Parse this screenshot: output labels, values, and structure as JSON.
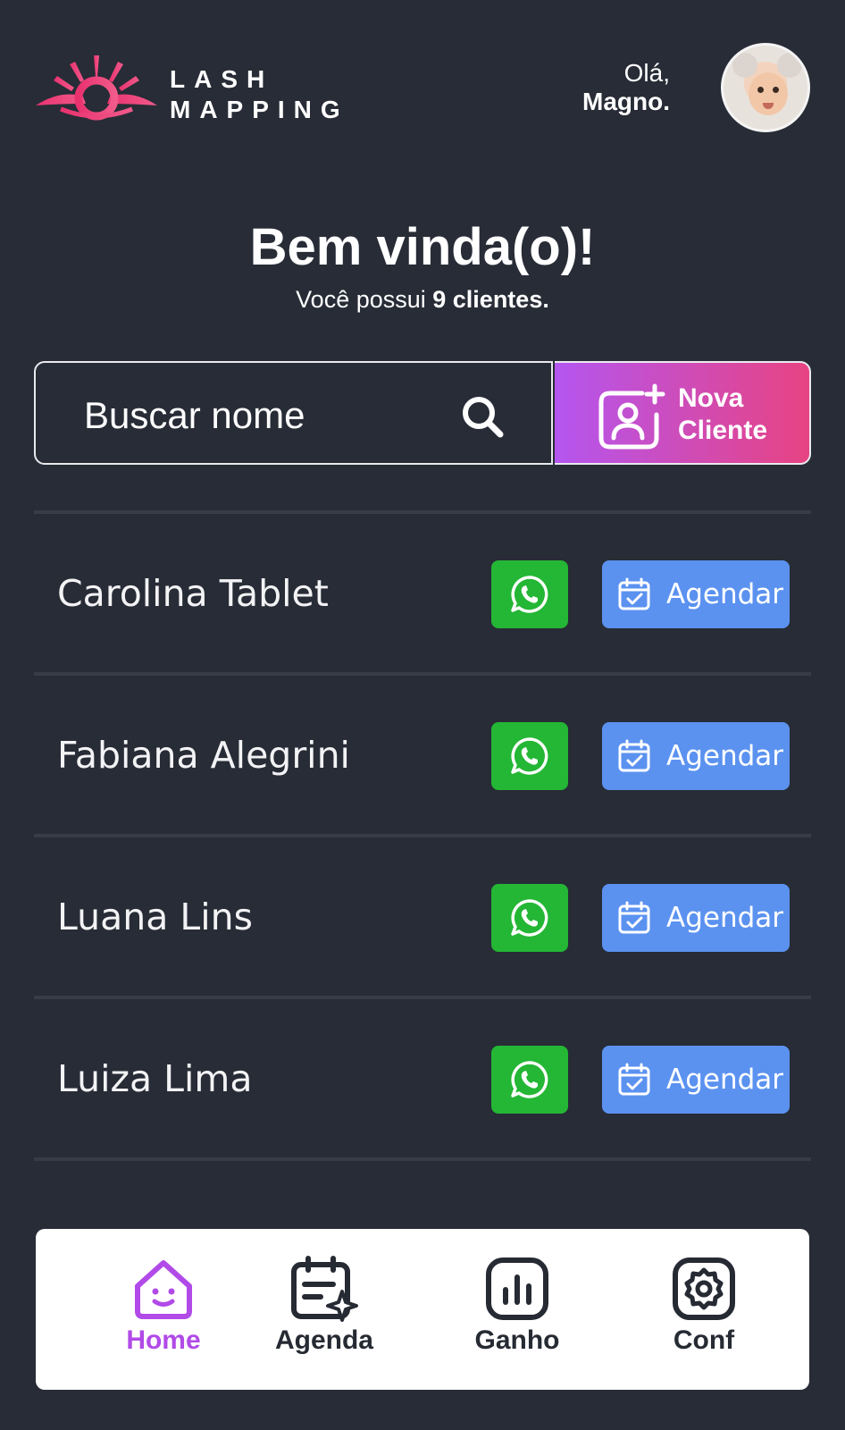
{
  "header": {
    "brand_line1": "LASH",
    "brand_line2": "MAPPING",
    "greeting": "Olá,",
    "user_name": "Magno."
  },
  "welcome": {
    "title": "Bem vinda(o)!",
    "subtitle_prefix": "Você possui ",
    "subtitle_count": "9 clientes."
  },
  "search": {
    "placeholder": "Buscar nome"
  },
  "new_client": {
    "line1": "Nova",
    "line2": "Cliente"
  },
  "clients": [
    {
      "name": "Carolina Tablet",
      "schedule_label": "Agendar"
    },
    {
      "name": "Fabiana Alegrini",
      "schedule_label": "Agendar"
    },
    {
      "name": "Luana Lins",
      "schedule_label": "Agendar"
    },
    {
      "name": "Luiza Lima",
      "schedule_label": "Agendar"
    }
  ],
  "nav": {
    "items": [
      {
        "label": "Home",
        "icon": "home-icon",
        "active": true
      },
      {
        "label": "Agenda",
        "icon": "calendar-icon",
        "active": false
      },
      {
        "label": "Ganho",
        "icon": "chart-icon",
        "active": false
      },
      {
        "label": "Conf",
        "icon": "gear-icon",
        "active": false
      }
    ]
  },
  "colors": {
    "background": "#272c36",
    "whatsapp": "#24b635",
    "schedule": "#5b92f0",
    "accent_purple": "#b14ae8",
    "accent_pink": "#e74382"
  }
}
